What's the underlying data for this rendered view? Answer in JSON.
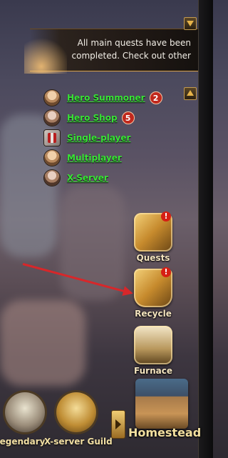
{
  "quest_banner": {
    "text": "All main quests have been completed. Check out other"
  },
  "quest_list": [
    {
      "label": "Hero Summoner",
      "badge": "2"
    },
    {
      "label": "Hero Shop",
      "badge": "5"
    },
    {
      "label": "Single-player",
      "badge": null
    },
    {
      "label": "Multiplayer",
      "badge": null
    },
    {
      "label": "X-Server",
      "badge": null
    }
  ],
  "side_buttons": {
    "quests": {
      "label": "Quests",
      "alert": "!"
    },
    "recycle": {
      "label": "Recycle",
      "alert": "!"
    },
    "furnace": {
      "label": "Furnace"
    }
  },
  "bottom_bar": {
    "legendary_label": "Legendary",
    "xserver_label": "X-server Guild",
    "homestead_label": "Homestead"
  },
  "colors": {
    "link_green": "#39e336",
    "badge_red": "#c0281d",
    "arrow_red": "#d7272a",
    "gold": "#e6b34a"
  }
}
